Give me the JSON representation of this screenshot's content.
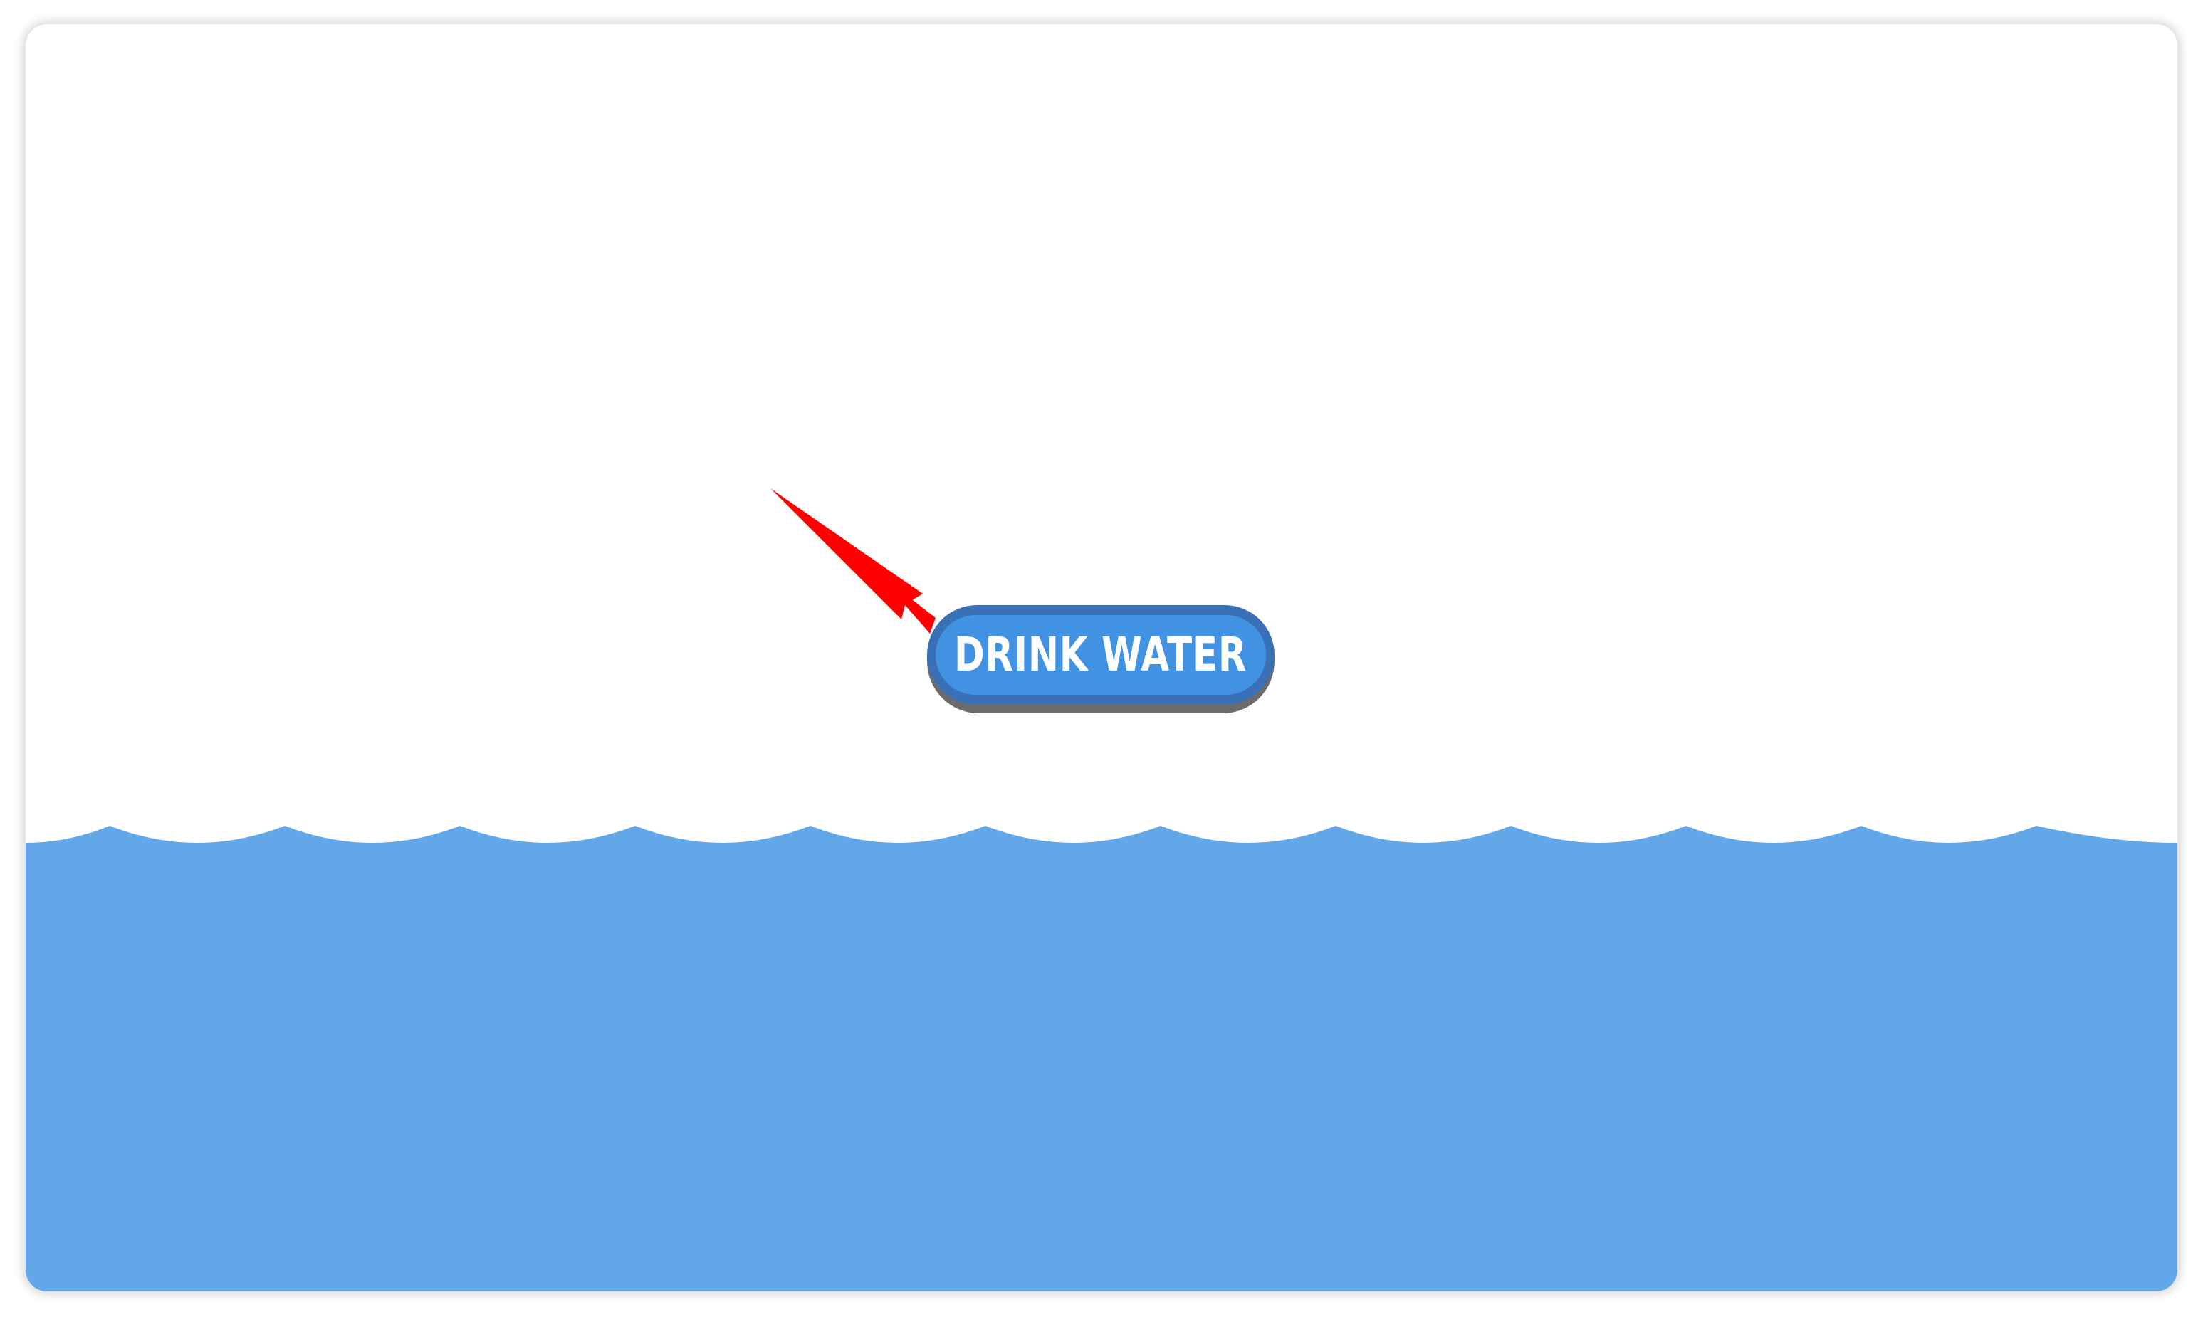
{
  "main": {
    "button_label": "DRINK WATER"
  },
  "colors": {
    "water": "#62a7e7",
    "button_outer": "#3a70b5",
    "button_inner": "#4292e4",
    "button_shadow": "#6b6b6b",
    "arrow": "#ff0000"
  },
  "icons": {
    "pointer": "red-arrow-icon",
    "waves": "water-waves"
  }
}
